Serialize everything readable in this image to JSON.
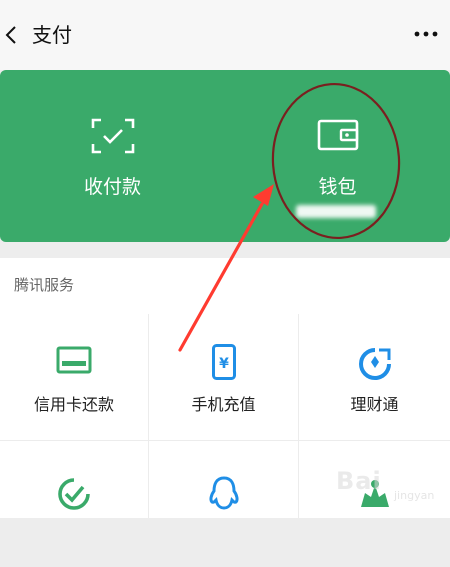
{
  "header": {
    "title": "支付",
    "back_icon": "chevron-left-icon",
    "more_icon": "more-horizontal-icon"
  },
  "payment_card": {
    "background_color": "#3aaa6a",
    "actions": [
      {
        "id": "receive-pay",
        "label": "收付款",
        "icon": "scan-check-icon"
      },
      {
        "id": "wallet",
        "label": "钱包",
        "icon": "wallet-icon"
      }
    ]
  },
  "tencent_services": {
    "section_title": "腾讯服务",
    "items": [
      {
        "id": "credit-card-repay",
        "label": "信用卡还款",
        "icon": "credit-card-icon"
      },
      {
        "id": "phone-topup",
        "label": "手机充值",
        "icon": "mobile-yen-icon"
      },
      {
        "id": "wealth",
        "label": "理财通",
        "icon": "wealth-icon"
      },
      {
        "id": "service-4",
        "label": "",
        "icon": "check-circle-icon"
      },
      {
        "id": "service-5",
        "label": "",
        "icon": "qq-penguin-icon"
      },
      {
        "id": "service-6",
        "label": "",
        "icon": "green-service-icon"
      }
    ]
  },
  "annotation": {
    "circle_color": "#7a1f1f",
    "arrow_color": "#ff3b30"
  },
  "watermark": {
    "text": "Bai",
    "sub_text": "jingyan"
  }
}
